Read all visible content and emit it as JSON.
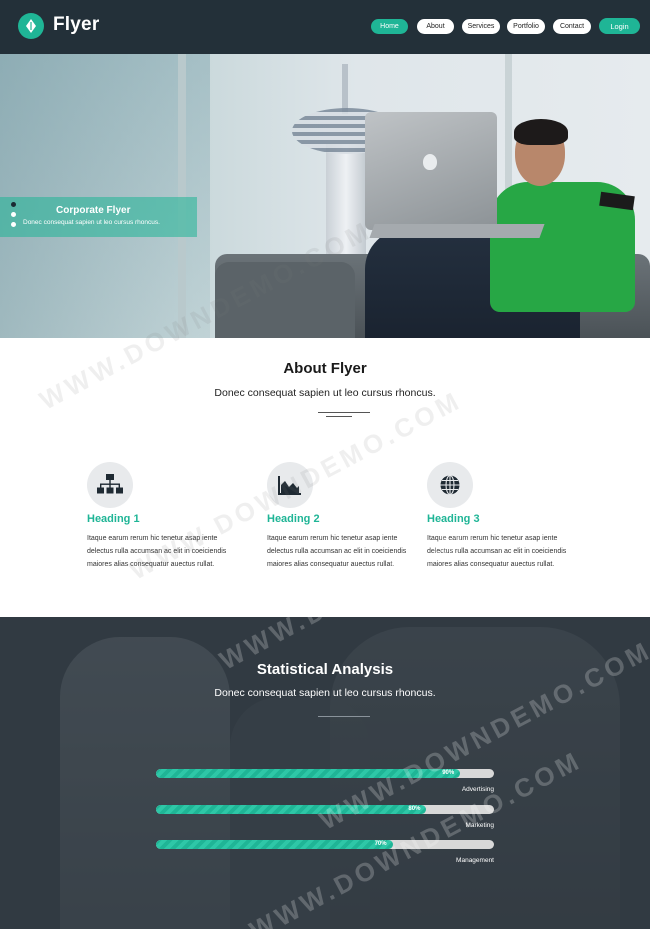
{
  "brand": {
    "name": "Flyer",
    "logo_icon": "leaf-drop-icon"
  },
  "nav": {
    "items": [
      {
        "label": "Home",
        "active": true
      },
      {
        "label": "About",
        "active": false
      },
      {
        "label": "Services",
        "active": false
      },
      {
        "label": "Portfolio",
        "active": false
      },
      {
        "label": "Contact",
        "active": false
      }
    ],
    "login_label": "Login"
  },
  "hero": {
    "title": "Corporate Flyer",
    "subtitle": "Donec consequat sapien ut leo cursus rhoncus.",
    "slides": 3,
    "active_slide": 1
  },
  "about": {
    "title": "About Flyer",
    "subtitle": "Donec consequat sapien ut leo cursus rhoncus.",
    "features": [
      {
        "icon": "sitemap-icon",
        "heading": "Heading 1",
        "text": "Itaque earum rerum hic tenetur asap iente delectus rulla accumsan ac elit in coeiciendis maiores alias consequatur auectus rullat."
      },
      {
        "icon": "area-chart-icon",
        "heading": "Heading 2",
        "text": "Itaque earum rerum hic tenetur asap iente delectus rulla accumsan ac elit in coeiciendis maiores alias consequatur auectus rullat."
      },
      {
        "icon": "globe-icon",
        "heading": "Heading 3",
        "text": "Itaque earum rerum hic tenetur asap iente delectus rulla accumsan ac elit in coeiciendis maiores alias consequatur auectus rullat."
      }
    ]
  },
  "stats": {
    "title": "Statistical Analysis",
    "subtitle": "Donec consequat sapien ut leo cursus rhoncus.",
    "bars": [
      {
        "label": "Advertising",
        "percent": 90,
        "percent_text": "90%"
      },
      {
        "label": "Marketing",
        "percent": 80,
        "percent_text": "80%"
      },
      {
        "label": "Management",
        "percent": 70,
        "percent_text": "70%"
      }
    ]
  },
  "watermark": "WWW.DOWNDEMO.COM",
  "colors": {
    "accent": "#1fb596",
    "navbar": "#233039",
    "stats_bg": "#3a434c"
  }
}
